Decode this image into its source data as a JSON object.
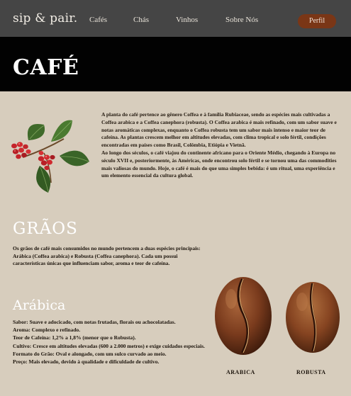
{
  "header": {
    "logo": "sip & pair.",
    "nav": [
      "Cafés",
      "Chás",
      "Vinhos",
      "Sobre Nós"
    ],
    "profile_label": "Perfil"
  },
  "banner": {
    "title": "CAFÉ"
  },
  "intro": {
    "paragraph_1": "A planta do café pertence ao gênero Coffea e à família Rubiaceae, sendo as espécies mais cultivadas a Coffea arabica e a Coffea canephora (robusta). O Coffea arabica é mais refinado, com um sabor suave e notas aromáticas complexas, enquanto o Coffea robusta tem um sabor mais intenso e maior teor de cafeína. As plantas crescem melhor em altitudes elevadas, com clima tropical e solo fértil, condições encontradas em países como Brasil, Colômbia, Etiópia e Vietnã.",
    "paragraph_2": "Ao longo dos séculos, o café viajou do continente africano para o Oriente Médio, chegando à Europa no século XVII e, posteriormente, às Américas, onde encontrou solo fértil e se tornou uma das commodities mais valiosas do mundo. Hoje, o café é mais do que uma simples bebida: é um ritual, uma experiência e um elemento essencial da cultura global."
  },
  "graos": {
    "title": "GRÃOS",
    "text": "Os grãos de café mais consumidos no mundo pertencem a duas espécies principais: Arábica (Coffea arabica) e Robusta (Coffea canephora). Cada um possui características únicas que influenciam sabor, aroma e teor de cafeína."
  },
  "arabica": {
    "title": "Arábica",
    "items": [
      "Sabor: Suave e adocicado, com notas frutadas, florais ou achocolatadas.",
      "Aroma: Complexo e refinado.",
      "Teor de Cafeína: 1,2% a 1,8% (menor que o Robusta).",
      "Cultivo: Cresce em altitudes elevadas (600 a 2.000 metros) e exige cuidados especiais.",
      "Formato do Grão: Oval e alongado, com um sulco curvado ao meio.",
      "Preço: Mais elevado, devido à qualidade e dificuldade de cultivo."
    ]
  },
  "beans": {
    "arabica_label": "ARABICA",
    "robusta_label": "ROBUSTA"
  },
  "colors": {
    "nav_bg": "#454545",
    "banner_bg": "#020202",
    "page_bg": "#d7cdbd",
    "profile_btn": "#7a3616",
    "leaf": "#3f6a2a",
    "cherry": "#c4232a"
  },
  "icons": [
    "coffee-plant-illustration",
    "arabica-bean-image",
    "robusta-bean-image"
  ]
}
